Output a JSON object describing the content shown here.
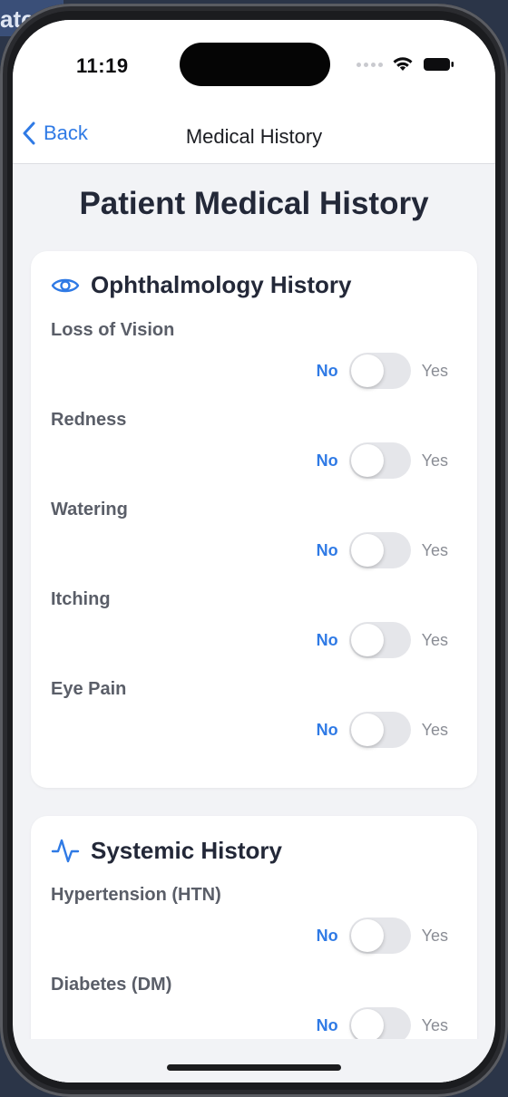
{
  "backdrop": {
    "fragment_text": "atc"
  },
  "status_bar": {
    "time": "11:19"
  },
  "nav": {
    "back_label": "Back",
    "title": "Medical History"
  },
  "page": {
    "title": "Patient Medical History"
  },
  "sections": [
    {
      "title": "Ophthalmology History",
      "icon": "eye-icon",
      "items": [
        {
          "label": "Loss of Vision",
          "no": "No",
          "yes": "Yes",
          "value": false
        },
        {
          "label": "Redness",
          "no": "No",
          "yes": "Yes",
          "value": false
        },
        {
          "label": "Watering",
          "no": "No",
          "yes": "Yes",
          "value": false
        },
        {
          "label": "Itching",
          "no": "No",
          "yes": "Yes",
          "value": false
        },
        {
          "label": "Eye Pain",
          "no": "No",
          "yes": "Yes",
          "value": false
        }
      ]
    },
    {
      "title": "Systemic History",
      "icon": "activity-icon",
      "items": [
        {
          "label": "Hypertension (HTN)",
          "no": "No",
          "yes": "Yes",
          "value": false
        },
        {
          "label": "Diabetes (DM)",
          "no": "No",
          "yes": "Yes",
          "value": false
        }
      ]
    }
  ],
  "colors": {
    "accent": "#2f7ae5",
    "background": "#f2f3f6",
    "card": "#ffffff",
    "switch_off": "#e5e6ea"
  }
}
